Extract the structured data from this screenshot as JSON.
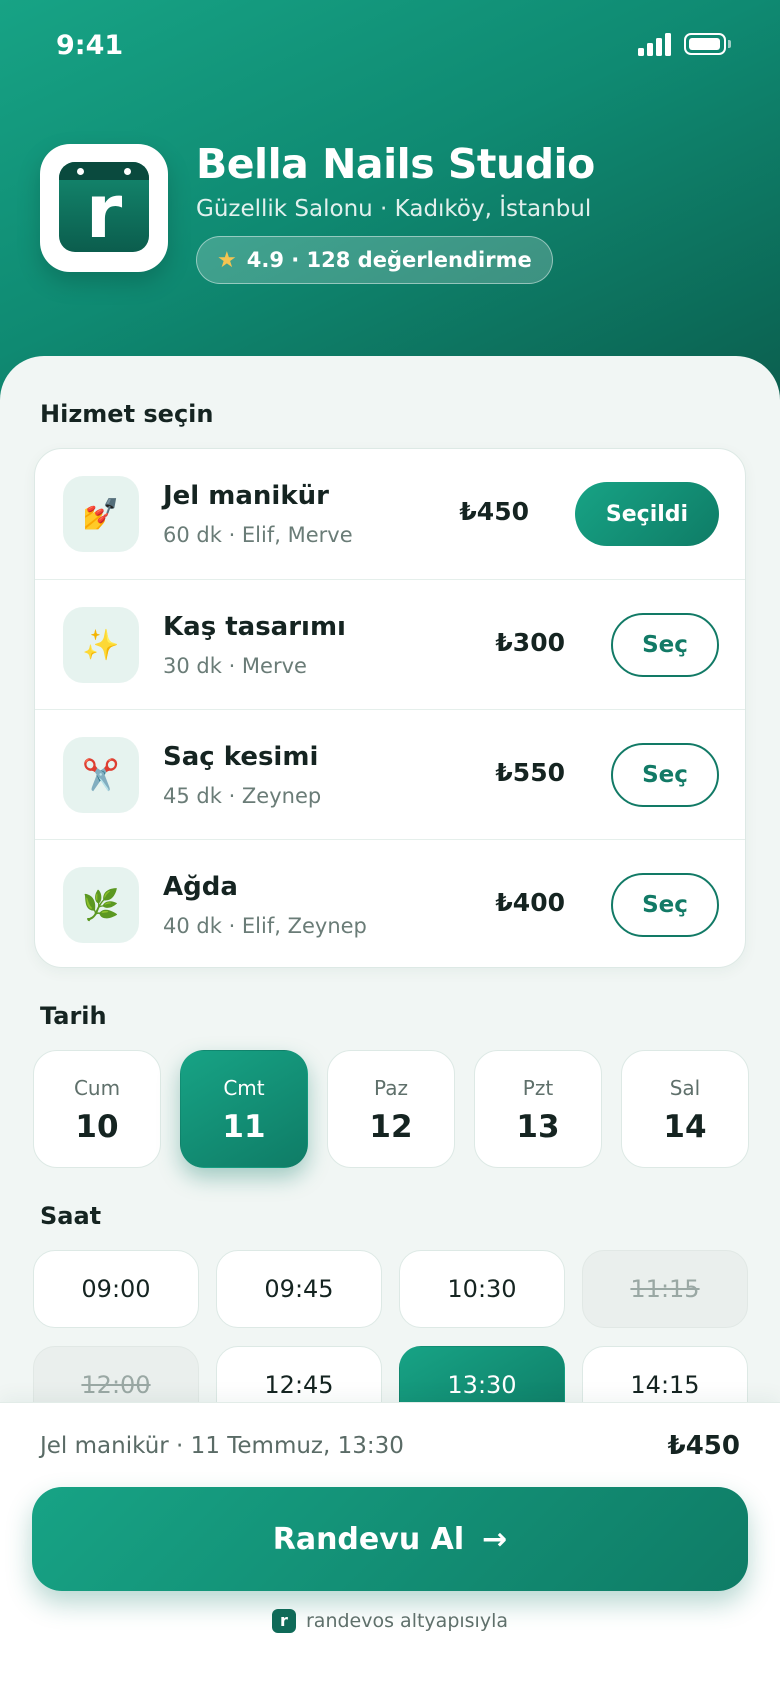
{
  "status_bar": {
    "time": "9:41"
  },
  "salon": {
    "logo_letter": "r",
    "name": "Bella Nails Studio",
    "subtitle": "Güzellik Salonu · Kadıköy, İstanbul",
    "rating": "4.9 · 128 değerlendirme"
  },
  "services": {
    "title": "Hizmet seçin",
    "items": [
      {
        "icon": "💅",
        "name": "Jel manikür",
        "meta": "60 dk · Elif, Merve",
        "price": "₺450",
        "button": "Seçildi",
        "selected": true
      },
      {
        "icon": "✨",
        "name": "Kaş tasarımı",
        "meta": "30 dk · Merve",
        "price": "₺300",
        "button": "Seç",
        "selected": false
      },
      {
        "icon": "✂️",
        "name": "Saç kesimi",
        "meta": "45 dk · Zeynep",
        "price": "₺550",
        "button": "Seç",
        "selected": false
      },
      {
        "icon": "🌿",
        "name": "Ağda",
        "meta": "40 dk · Elif, Zeynep",
        "price": "₺400",
        "button": "Seç",
        "selected": false
      }
    ]
  },
  "dates": {
    "title": "Tarih",
    "items": [
      {
        "dow": "Cum",
        "day": "10"
      },
      {
        "dow": "Cmt",
        "day": "11"
      },
      {
        "dow": "Paz",
        "day": "12"
      },
      {
        "dow": "Pzt",
        "day": "13"
      },
      {
        "dow": "Sal",
        "day": "14"
      }
    ],
    "selected_index": 1
  },
  "times": {
    "title": "Saat",
    "items": [
      {
        "label": "09:00",
        "state": "available"
      },
      {
        "label": "09:45",
        "state": "available"
      },
      {
        "label": "10:30",
        "state": "available"
      },
      {
        "label": "11:15",
        "state": "disabled"
      },
      {
        "label": "12:00",
        "state": "disabled"
      },
      {
        "label": "12:45",
        "state": "available"
      },
      {
        "label": "13:30",
        "state": "selected"
      },
      {
        "label": "14:15",
        "state": "available"
      }
    ]
  },
  "summary": {
    "text": "Jel manikür · 11 Temmuz, 13:30",
    "price": "₺450"
  },
  "cta": {
    "label": "Randevu Al",
    "arrow": "→"
  },
  "footer": {
    "logo_letter": "r",
    "text": "randevos altyapısıyla"
  },
  "colors": {
    "accent": "#17a385",
    "accent_dark": "#0f7c66",
    "rating_star": "#f5c451"
  }
}
